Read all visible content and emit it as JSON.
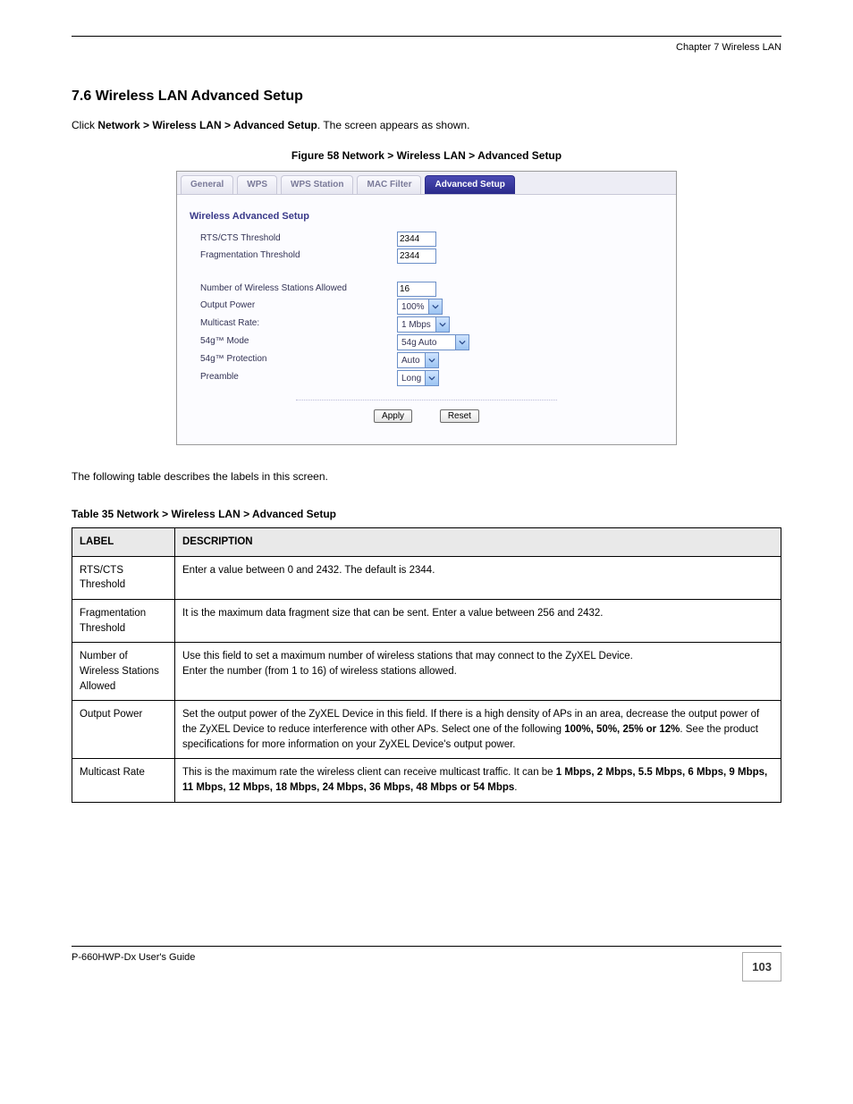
{
  "header": {
    "chapter": "Chapter 7 Wireless LAN"
  },
  "section": {
    "number_title": "7.6  Wireless LAN Advanced Setup",
    "intro": "Click Network > Wireless LAN > Advanced Setup. The screen appears as shown.",
    "figure_caption": "Figure 58   Network > Wireless LAN > Advanced Setup",
    "table_intro": "The following table describes the labels in this screen.",
    "table_caption": "Table 35   Network > Wireless LAN > Advanced Setup"
  },
  "ui": {
    "tabs": {
      "general": "General",
      "wps": "WPS",
      "wps_station": "WPS Station",
      "mac_filter": "MAC Filter",
      "advanced_setup": "Advanced Setup"
    },
    "section_title": "Wireless Advanced Setup",
    "labels": {
      "rts": "RTS/CTS  Threshold",
      "frag": "Fragmentation  Threshold",
      "stations": "Number of Wireless Stations Allowed",
      "output_power": "Output Power",
      "multicast": "Multicast Rate:",
      "mode54g": "54g™ Mode",
      "prot54g": "54g™ Protection",
      "preamble": "Preamble"
    },
    "values": {
      "rts": "2344",
      "frag": "2344",
      "stations": "16",
      "output_power": "100%",
      "multicast": "1 Mbps",
      "mode54g": "54g Auto",
      "prot54g": "Auto",
      "preamble": "Long"
    },
    "buttons": {
      "apply": "Apply",
      "reset": "Reset"
    }
  },
  "table": {
    "head_label": "LABEL",
    "head_desc": "DESCRIPTION",
    "rows": [
      {
        "label": "RTS/CTS Threshold",
        "desc_a": "Enter a value between 0 and 2432. The default is 2344.",
        "desc_b": ""
      },
      {
        "label": "Fragmentation Threshold",
        "desc_a": "It is the maximum data fragment size that can be sent. Enter a value between 256 and 2432.",
        "desc_b": ""
      },
      {
        "label": "Number of Wireless Stations Allowed",
        "desc_a": "Use this field to set a maximum number of wireless stations that may connect to the ZyXEL Device.",
        "desc_b": "Enter the number (from 1 to 16) of wireless stations allowed."
      },
      {
        "label": "Output Power",
        "desc_a": "Set the output power of the ZyXEL Device in this field. If there is a high density of APs in an area, decrease the output power of the ZyXEL Device to reduce interference with other APs. Select one of the following ",
        "desc_b": ". See the product specifications for more information on your ZyXEL Device's output power.",
        "bold_mid": "100%, 50%, 25% or 12%"
      },
      {
        "label": "Multicast Rate",
        "desc_a": "This is the maximum rate the wireless client can receive multicast traffic. It can be ",
        "desc_b": ".",
        "bold_mid": "1 Mbps, 2 Mbps, 5.5 Mbps, 6 Mbps, 9 Mbps, 11 Mbps, 12 Mbps, 18 Mbps, 24 Mbps, 36 Mbps, 48 Mbps or 54 Mbps"
      }
    ]
  },
  "footer": {
    "guide": "P-660HWP-Dx User's Guide",
    "page": "103"
  }
}
